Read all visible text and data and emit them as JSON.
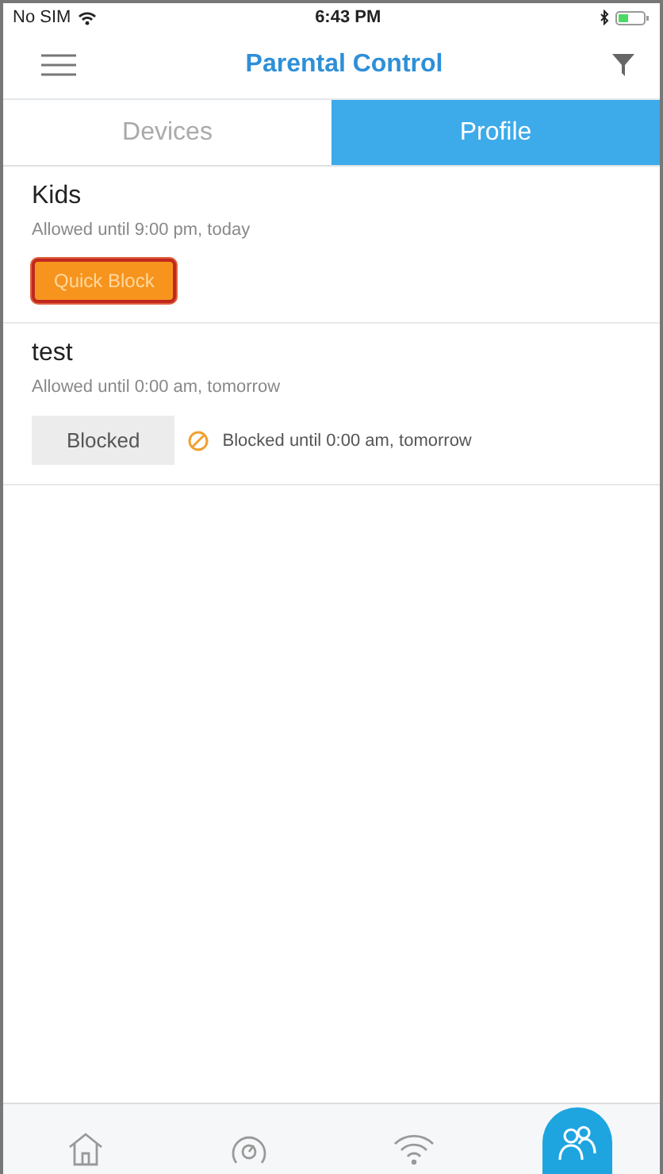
{
  "status_bar": {
    "carrier": "No SIM",
    "time": "6:43 PM"
  },
  "header": {
    "title": "Parental Control"
  },
  "tabs": [
    {
      "label": "Devices",
      "selected": false
    },
    {
      "label": "Profile",
      "selected": true
    }
  ],
  "profiles": [
    {
      "name": "Kids",
      "schedule": "Allowed until 9:00 pm, today",
      "kind": "quick",
      "button": "Quick Block",
      "highlighted": true
    },
    {
      "name": "test",
      "schedule": "Allowed until 0:00 am, tomorrow",
      "kind": "blocked",
      "button": "Blocked",
      "note": "Blocked until 0:00 am, tomorrow",
      "highlighted": false
    }
  ],
  "bottom_nav": [
    {
      "kind": "home",
      "selected": false
    },
    {
      "kind": "speed",
      "selected": false
    },
    {
      "kind": "wifi",
      "selected": false
    },
    {
      "kind": "people",
      "selected": true
    }
  ]
}
